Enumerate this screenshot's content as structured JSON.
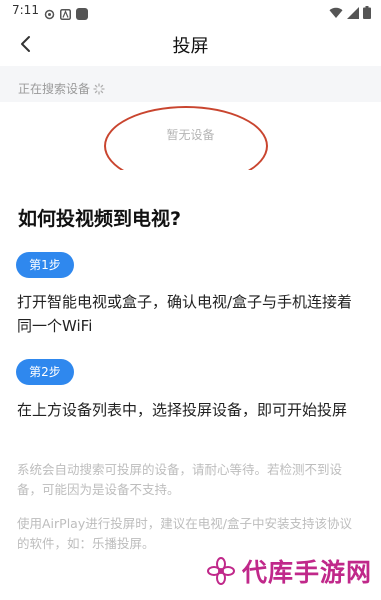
{
  "status_bar": {
    "time": "7:11",
    "left_icons": [
      "settings-status-icon",
      "a-status-icon",
      "app-status-icon"
    ],
    "right_icons": [
      "wifi-icon",
      "signal-icon",
      "battery-icon"
    ]
  },
  "header": {
    "title": "投屏",
    "back_icon": "chevron-left-icon"
  },
  "device_search": {
    "status_text": "正在搜索设备",
    "empty_text": "暂无设备",
    "highlight_color": "#c9452f"
  },
  "help": {
    "title": "如何投视频到电视?",
    "steps": [
      {
        "badge": "第1步",
        "text": "打开智能电视或盒子，确认电视/盒子与手机连接着同一个WiFi"
      },
      {
        "badge": "第2步",
        "text": "在上方设备列表中，选择投屏设备，即可开始投屏"
      }
    ],
    "notes": [
      "系统会自动搜索可投屏的设备，请耐心等待。若检测不到设备，可能因为是设备不支持。",
      "使用AirPlay进行投屏时，建议在电视/盒子中安装支持该协议的软件，如：乐播投屏。"
    ],
    "accent_color": "#2f88ee"
  },
  "watermark": {
    "text": "代库手游网",
    "icon": "flower-logo-icon",
    "color": "#c0288a"
  }
}
